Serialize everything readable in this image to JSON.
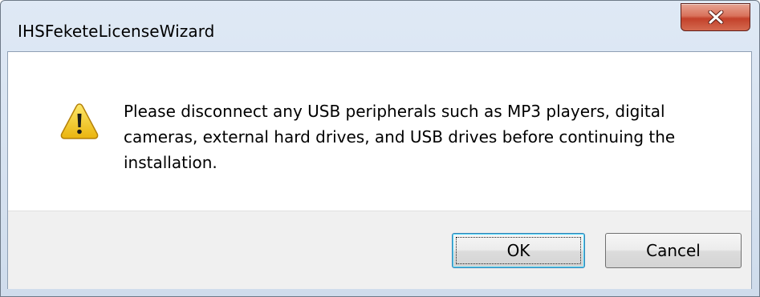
{
  "window": {
    "title": "IHSFeketeLicenseWizard",
    "close_icon": "close-icon"
  },
  "dialog": {
    "icon": "warning-icon",
    "message": "Please disconnect any USB peripherals such as MP3 players, digital cameras, external hard drives, and USB drives before continuing the installation.",
    "buttons": {
      "ok_label": "OK",
      "cancel_label": "Cancel"
    }
  },
  "colors": {
    "close_button": "#c3412a",
    "warning_yellow": "#f7c829",
    "default_button_border": "#3c7fb1"
  }
}
